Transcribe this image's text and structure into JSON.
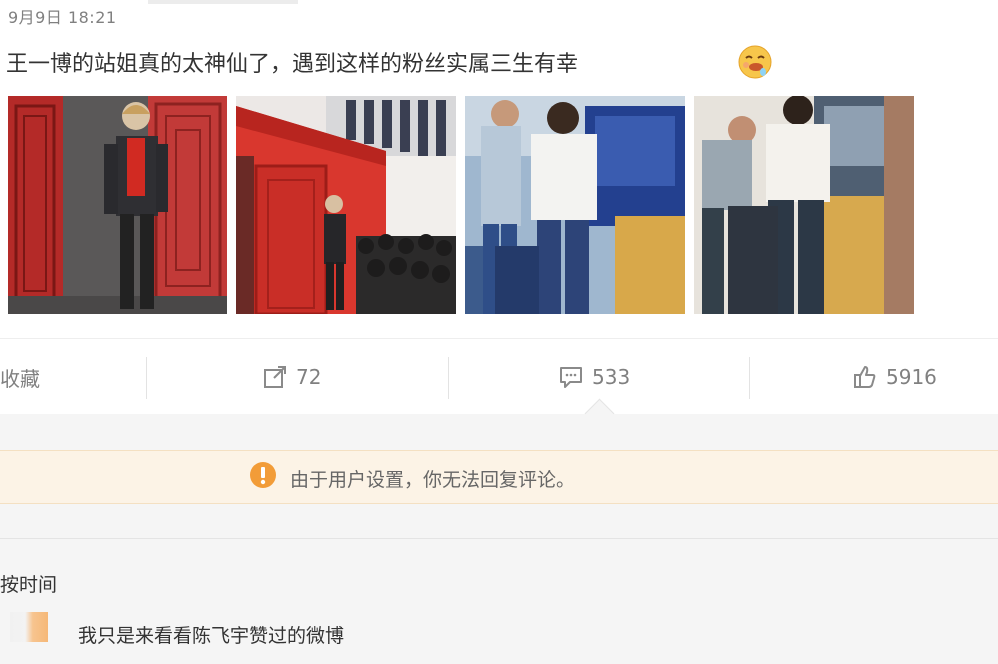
{
  "post": {
    "timestamp": "9月9日 18:21",
    "text": "王一博的站姐真的太神仙了，遇到这样的粉丝实属三生有幸",
    "emoji": "drooling-face-emoji",
    "photos": [
      {
        "name": "photo-red-wall-portrait"
      },
      {
        "name": "photo-red-stage-crowd"
      },
      {
        "name": "photo-luggage-helper-1"
      },
      {
        "name": "photo-luggage-helper-2"
      }
    ]
  },
  "actions": {
    "favorite_label": "收藏",
    "favorite_visible": "收藏",
    "share_count": "72",
    "comment_count": "533",
    "like_count": "5916"
  },
  "comments": {
    "notice": "由于用户设置，你无法回复评论。",
    "sort_label": "按时间",
    "items": [
      {
        "text": "我只是来看看陈飞宇赞过的微博"
      }
    ]
  },
  "colors": {
    "notice_bg": "#fcf3e6",
    "notice_icon": "#f29c38",
    "muted_text": "#808080"
  }
}
